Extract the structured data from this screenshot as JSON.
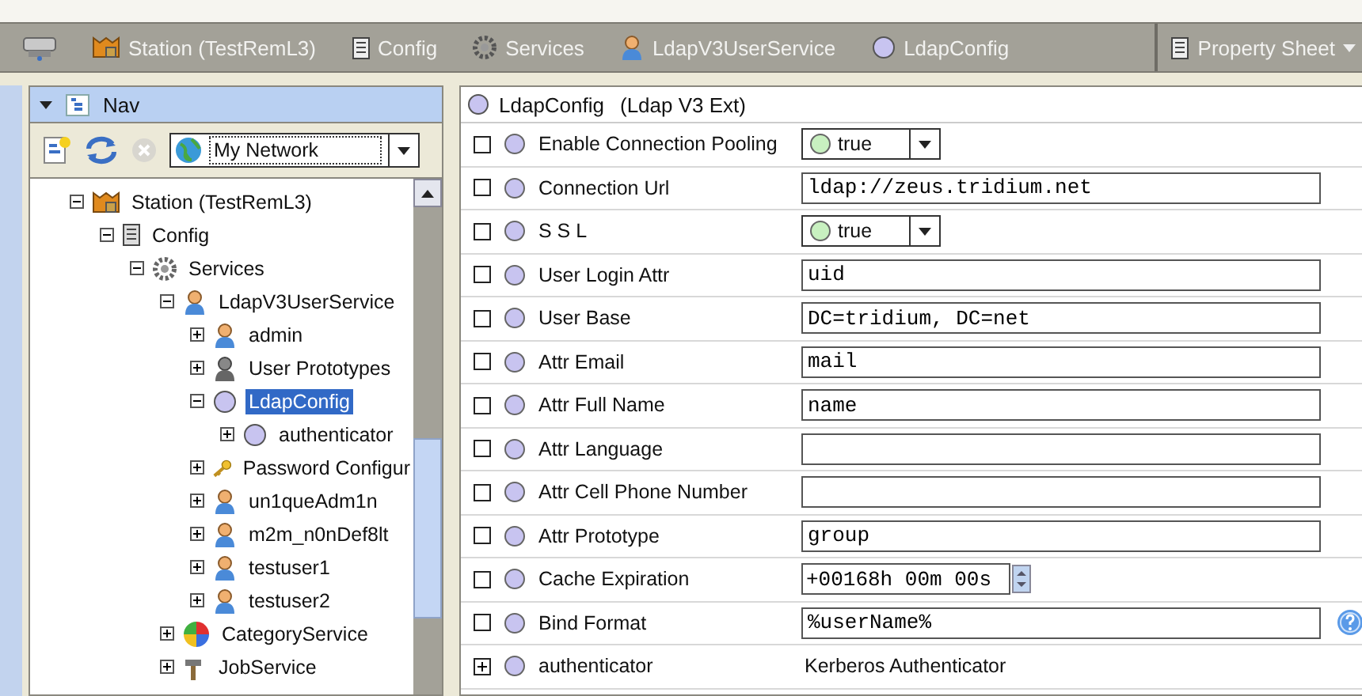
{
  "breadcrumbs": [
    {
      "kind": "station",
      "label": "Station (TestRemL3)"
    },
    {
      "kind": "config",
      "label": "Config"
    },
    {
      "kind": "services",
      "label": "Services"
    },
    {
      "kind": "user",
      "label": "LdapV3UserService"
    },
    {
      "kind": "ldap",
      "label": "LdapConfig"
    }
  ],
  "view_selector": {
    "label": "Property Sheet"
  },
  "nav": {
    "title": "Nav",
    "network": "My Network",
    "tree": [
      {
        "kind": "station",
        "label": "Station (TestRemL3)",
        "expanded": true,
        "selected": false,
        "children": [
          {
            "kind": "config",
            "label": "Config",
            "expanded": true,
            "selected": false,
            "children": [
              {
                "kind": "services",
                "label": "Services",
                "expanded": true,
                "selected": false,
                "children": [
                  {
                    "kind": "user",
                    "label": "LdapV3UserService",
                    "expanded": true,
                    "selected": false,
                    "children": [
                      {
                        "kind": "user",
                        "label": "admin",
                        "expanded": false,
                        "selected": false
                      },
                      {
                        "kind": "prototype",
                        "label": "User Prototypes",
                        "expanded": false,
                        "selected": false
                      },
                      {
                        "kind": "ldap",
                        "label": "LdapConfig",
                        "expanded": true,
                        "selected": true,
                        "children": [
                          {
                            "kind": "ldap",
                            "label": "authenticator",
                            "expanded": false,
                            "selected": false
                          }
                        ]
                      },
                      {
                        "kind": "key",
                        "label": "Password Configur",
                        "expanded": false,
                        "selected": false
                      },
                      {
                        "kind": "user",
                        "label": "un1queAdm1n",
                        "expanded": false,
                        "selected": false
                      },
                      {
                        "kind": "user",
                        "label": "m2m_n0nDef8lt",
                        "expanded": false,
                        "selected": false
                      },
                      {
                        "kind": "user",
                        "label": "testuser1",
                        "expanded": false,
                        "selected": false
                      },
                      {
                        "kind": "user",
                        "label": "testuser2",
                        "expanded": false,
                        "selected": false
                      }
                    ]
                  },
                  {
                    "kind": "category",
                    "label": "CategoryService",
                    "expanded": false,
                    "selected": false
                  },
                  {
                    "kind": "job",
                    "label": "JobService",
                    "expanded": false,
                    "selected": false
                  }
                ]
              }
            ]
          }
        ]
      }
    ]
  },
  "sheet": {
    "title": "LdapConfig",
    "subtitle": "(Ldap V3 Ext)",
    "rows": [
      {
        "kind": "enum",
        "label": "Enable Connection Pooling",
        "value": "true",
        "checked": false
      },
      {
        "kind": "text",
        "label": "Connection Url",
        "value": "ldap://zeus.tridium.net",
        "checked": false
      },
      {
        "kind": "enum",
        "label": "S S L",
        "value": "true",
        "checked": false
      },
      {
        "kind": "text",
        "label": "User Login Attr",
        "value": "uid",
        "checked": false
      },
      {
        "kind": "text",
        "label": "User Base",
        "value": "DC=tridium, DC=net",
        "checked": false
      },
      {
        "kind": "text",
        "label": "Attr Email",
        "value": "mail",
        "checked": false
      },
      {
        "kind": "text",
        "label": "Attr Full Name",
        "value": "name",
        "checked": false
      },
      {
        "kind": "text",
        "label": "Attr Language",
        "checked": false
      },
      {
        "kind": "text",
        "label": "Attr Cell Phone Number",
        "checked": false
      },
      {
        "kind": "text",
        "label": "Attr Prototype",
        "value": "group",
        "checked": false
      },
      {
        "kind": "time",
        "label": "Cache Expiration",
        "value": "+00168h 00m 00s",
        "checked": false
      },
      {
        "kind": "text",
        "label": "Bind Format",
        "value": "%userName%",
        "help": true,
        "checked": false
      },
      {
        "kind": "link",
        "label": "authenticator",
        "value": "Kerberos Authenticator",
        "expanded": false
      }
    ]
  }
}
